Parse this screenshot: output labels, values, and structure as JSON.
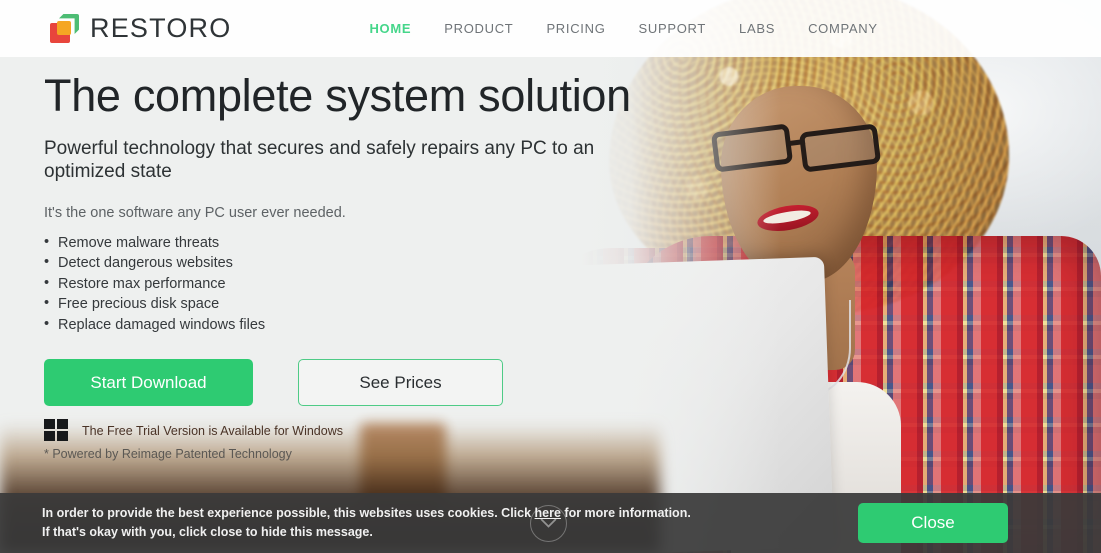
{
  "header": {
    "logo_text": "RESTORO",
    "logo_icon": "restoro-cube-logo",
    "nav": [
      {
        "label": "HOME",
        "active": true
      },
      {
        "label": "PRODUCT",
        "active": false
      },
      {
        "label": "PRICING",
        "active": false
      },
      {
        "label": "SUPPORT",
        "active": false
      },
      {
        "label": "LABS",
        "active": false
      },
      {
        "label": "COMPANY",
        "active": false
      }
    ]
  },
  "hero": {
    "headline": "The complete system solution",
    "subheadline": "Powerful technology that secures and safely repairs any PC to an optimized state",
    "tagline": "It's the one software any PC user ever needed.",
    "bullets": [
      "Remove malware threats",
      "Detect dangerous websites",
      "Restore max performance",
      "Free precious disk space",
      "Replace damaged windows files"
    ],
    "primary_cta": "Start Download",
    "secondary_cta": "See Prices",
    "windows_badge": "The Free Trial Version is Available for Windows",
    "windows_icon": "windows-logo-icon",
    "powered_by": "* Powered by Reimage Patented Technology"
  },
  "cookie_bar": {
    "line1_before_link": "In order to provide the best experience possible, this websites uses cookies. Click ",
    "link_label": "here",
    "line1_after_link": " for more information.",
    "line2": "If that's okay with you, click close to hide this message.",
    "close_label": "Close",
    "scroll_icon": "chevron-down-circle-icon"
  },
  "colors": {
    "brand_green": "#2ecb72",
    "nav_active_green": "#45d68a",
    "cookie_bar_bg": "#3a3a3a",
    "page_bg": "#eef0ef",
    "logo_green": "#4dbd74",
    "logo_orange": "#f5a623",
    "logo_red": "#e8453c"
  }
}
